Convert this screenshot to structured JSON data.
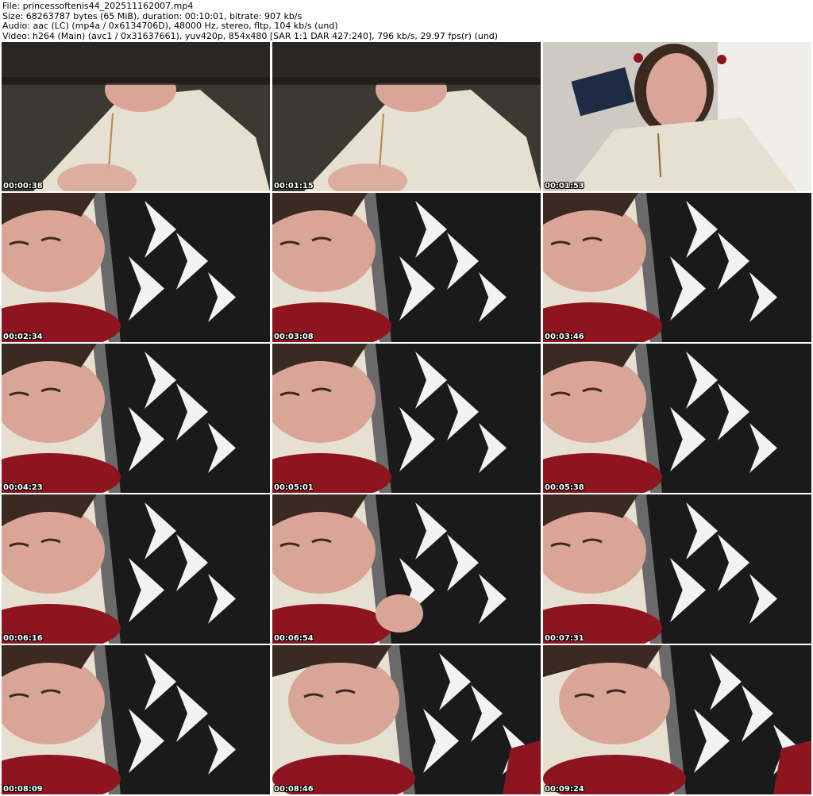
{
  "header": {
    "file_line": "File: princessoftenis44_202511162007.mp4",
    "size_line": "Size: 68263787 bytes (65 MiB), duration: 00:10:01, bitrate: 907 kb/s",
    "audio_line": "Audio: aac (LC) (mp4a / 0x6134706D), 48000 Hz, stereo, fltp, 104 kb/s (und)",
    "video_line": "Video: h264 (Main) (avc1 / 0x31637661), yuv420p, 854x480 [SAR 1:1 DAR 427:240], 796 kb/s, 29.97 fps(r) (und)"
  },
  "thumbnails": [
    {
      "timestamp": "00:00:38",
      "scene": "dark-top"
    },
    {
      "timestamp": "00:01:15",
      "scene": "dark-top"
    },
    {
      "timestamp": "00:01:53",
      "scene": "face-up"
    },
    {
      "timestamp": "00:02:34",
      "scene": "blanket"
    },
    {
      "timestamp": "00:03:08",
      "scene": "blanket"
    },
    {
      "timestamp": "00:03:46",
      "scene": "blanket"
    },
    {
      "timestamp": "00:04:23",
      "scene": "blanket"
    },
    {
      "timestamp": "00:05:01",
      "scene": "blanket"
    },
    {
      "timestamp": "00:05:38",
      "scene": "blanket"
    },
    {
      "timestamp": "00:06:16",
      "scene": "blanket"
    },
    {
      "timestamp": "00:06:54",
      "scene": "blanket-hand"
    },
    {
      "timestamp": "00:07:31",
      "scene": "blanket"
    },
    {
      "timestamp": "00:08:09",
      "scene": "blanket"
    },
    {
      "timestamp": "00:08:46",
      "scene": "blanket-red"
    },
    {
      "timestamp": "00:09:24",
      "scene": "blanket-red"
    }
  ],
  "colors": {
    "skin": "#d9a596",
    "hoodie": "#e6e0d2",
    "blanket_dark": "#1a1a1a",
    "blanket_light": "#f2f2f2",
    "red": "#8e1520",
    "hair": "#3b2a22",
    "timestamp_text": "#ffffff"
  }
}
